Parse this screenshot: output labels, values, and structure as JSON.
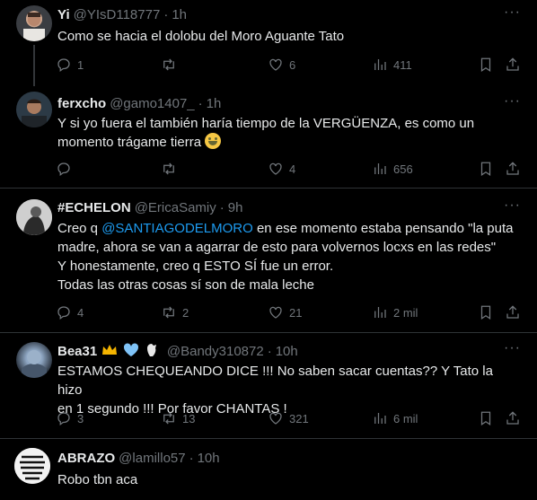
{
  "tweets": [
    {
      "name": "Yi",
      "handle": "@YIsD118777",
      "time": "1h",
      "text_lines": [
        "Como se hacia el dolobu del Moro Aguante Tato"
      ],
      "replies": "1",
      "retweets": "",
      "likes": "6",
      "views": "411"
    },
    {
      "name": "ferxcho",
      "handle": "@gamo1407_",
      "time": "1h",
      "text_lines": [
        "Y si yo fuera el también haría tiempo de la VERGÜENZA, es como un",
        "momento trágame tierra"
      ],
      "replies": "",
      "retweets": "",
      "likes": "4",
      "views": "656"
    },
    {
      "name": "#ECHELON",
      "handle": "@EricaSamiy",
      "time": "9h",
      "text_prefix": "Creo q ",
      "mention": "@SANTIAGODELMORO",
      "text_suffix": "  en ese momento estaba pensando \"la puta",
      "text_lines": [
        "madre, ahora se van a agarrar de esto para volvernos locxs en las redes\"",
        "Y honestamente, creo q ESTO SÍ fue un error.",
        "Todas las otras cosas sí son de mala leche"
      ],
      "replies": "4",
      "retweets": "2",
      "likes": "21",
      "views": "2 mil"
    },
    {
      "name": "Bea31",
      "handle": "@Bandy310872",
      "time": "10h",
      "text_lines": [
        "ESTAMOS CHEQUEANDO DICE !!! No saben  sacar cuentas??  Y Tato la hizo",
        "en 1 segundo !!! Por favor CHANTAS !"
      ],
      "replies": "3",
      "retweets": "13",
      "likes": "321",
      "views": "6 mil"
    },
    {
      "name": "ABRAZO",
      "handle": "@lamillo57",
      "time": "10h",
      "text_lines": [
        "Robo tbn aca"
      ],
      "avatar_text": "EL ARTE DE LA VIDA ES VIVIR EL PRESENTE"
    }
  ],
  "colors": {
    "accent": "#1d9bf0",
    "muted": "#71767b",
    "text": "#e7e9ea",
    "border": "#2f3336"
  },
  "icons": [
    "more-icon",
    "reply-icon",
    "retweet-icon",
    "like-icon",
    "views-icon",
    "bookmark-icon",
    "share-icon"
  ]
}
